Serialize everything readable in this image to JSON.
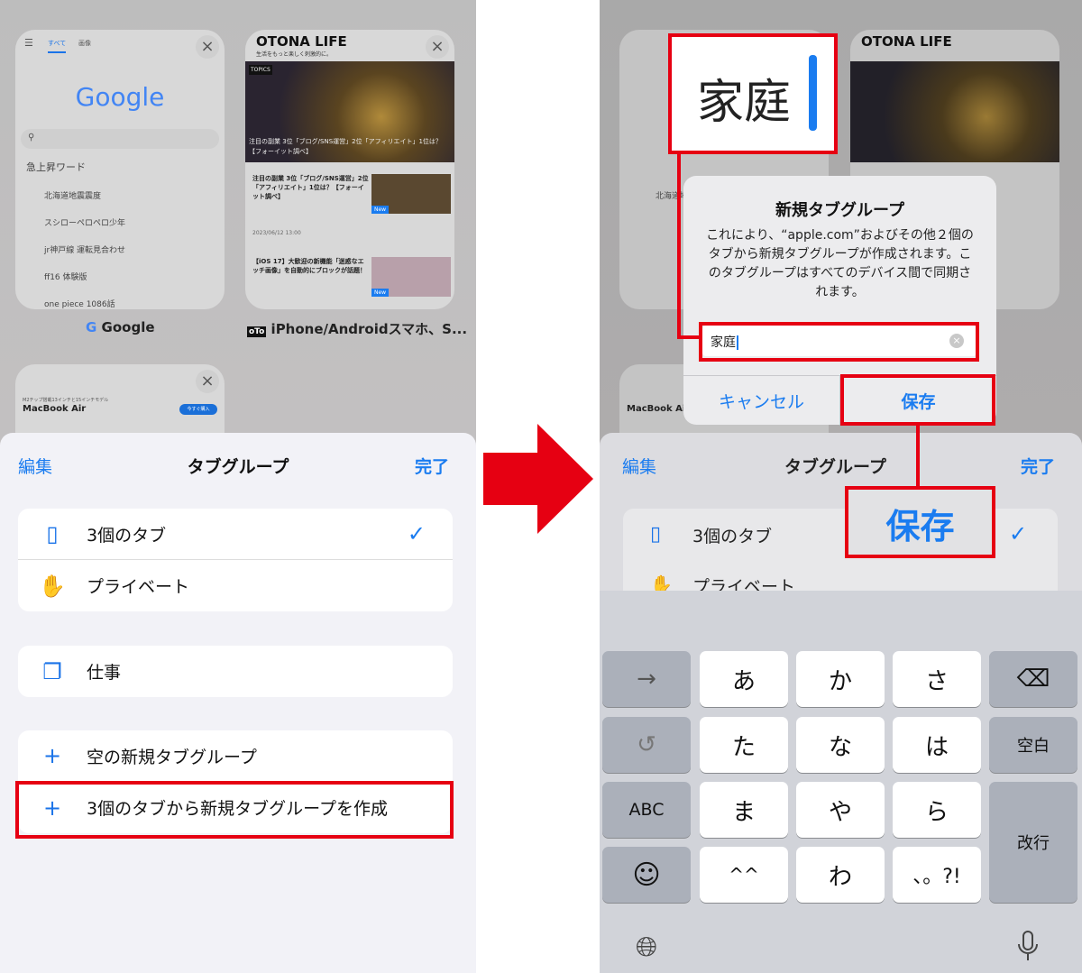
{
  "tabs": {
    "google": {
      "title": "Google",
      "tabs": [
        "すべて",
        "画像"
      ],
      "logo": "Google",
      "trending_header": "急上昇ワード",
      "trending": [
        "北海道地震震度",
        "スシローペロペロ少年",
        "jr神戸線 運転見合わせ",
        "ff16 体験版",
        "one piece 1086話"
      ]
    },
    "otona": {
      "title": "iPhone/Androidスマホ、S...",
      "logo": "OTONA LIFE",
      "tagline": "生活をもっと楽しく刺激的に。",
      "topics": "TOPICS",
      "headline": "注目の副業 3位「ブログ/SNS運営」2位「アフィリエイト」1位は？【フォーイット調べ】",
      "article1": "注目の副業 3位「ブログ/SNS運営」2位「アフィリエイト」1位は？【フォーイット調べ】",
      "article1_date": "2023/06/12 13:00",
      "article2": "【iOS 17】大歓迎の新機能「迷惑なエッチ画像」を自動的にブロックが話題！",
      "new_badge": "New"
    },
    "apple": {
      "subtitle": "M2チップ搭載13インチと15インチモデル",
      "title": "MacBook Air",
      "buy": "今すぐ購入"
    }
  },
  "sheet": {
    "edit": "編集",
    "title": "タブグループ",
    "done": "完了",
    "groups": [
      {
        "label": "3個のタブ",
        "icon": "iphone-icon",
        "checked": true
      },
      {
        "label": "プライベート",
        "icon": "hand-icon"
      }
    ],
    "saved": [
      {
        "label": "仕事",
        "icon": "tabs-icon"
      }
    ],
    "actions": [
      {
        "label": "空の新規タブグループ"
      },
      {
        "label": "3個のタブから新規タブグループを作成"
      }
    ]
  },
  "dialog": {
    "title": "新規タブグループ",
    "message": "これにより、“apple.com”およびその他２個のタブから新規タブグループが作成されます。このタブグループはすべてのデバイス間で同期されます。",
    "input_value": "家庭",
    "cancel": "キャンセル",
    "save": "保存"
  },
  "callouts": {
    "zoom_text": "家庭",
    "save_text": "保存"
  },
  "keyboard": {
    "rows": [
      [
        "→",
        "あ",
        "か",
        "さ",
        "⌫"
      ],
      [
        "↺",
        "た",
        "な",
        "は",
        "空白"
      ],
      [
        "ABC",
        "ま",
        "や",
        "ら"
      ],
      [
        "☺",
        "^^",
        "わ",
        "、。?!"
      ]
    ],
    "return": "改行"
  },
  "colors": {
    "accent": "#1a7cf0",
    "highlight": "#e60012"
  }
}
